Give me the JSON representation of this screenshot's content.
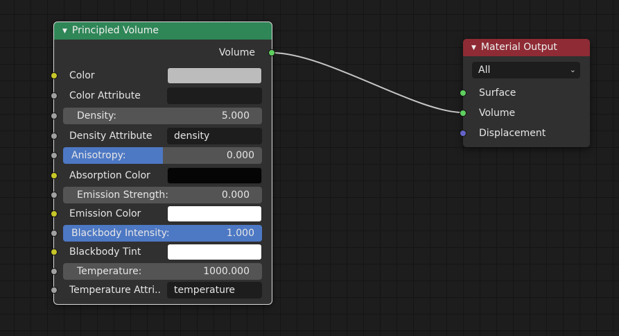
{
  "principled_volume": {
    "title": "Principled Volume",
    "header_color": "#2f8657",
    "output_label": "Volume",
    "color_label": "Color",
    "color_swatch": "#bcbcbc",
    "color_attribute_label": "Color Attribute",
    "color_attribute_value": "",
    "density": {
      "label": "Density:",
      "value": "5.000"
    },
    "density_attribute_label": "Density Attribute",
    "density_attribute_value": "density",
    "anisotropy": {
      "label": "Anisotropy:",
      "value": "0.000",
      "fill_fraction": 0.5
    },
    "absorption_color_label": "Absorption Color",
    "absorption_swatch": "#050505",
    "emission_strength": {
      "label": "Emission Strength:",
      "value": "0.000"
    },
    "emission_color_label": "Emission Color",
    "emission_swatch": "#ffffff",
    "blackbody_intensity": {
      "label": "Blackbody Intensity:",
      "value": "1.000",
      "fill_fraction": 1.0
    },
    "blackbody_tint_label": "Blackbody Tint",
    "blackbody_tint_swatch": "#ffffff",
    "temperature": {
      "label": "Temperature:",
      "value": "1000.000"
    },
    "temperature_attribute_label": "Temperature Attri..",
    "temperature_attribute_value": "temperature"
  },
  "material_output": {
    "title": "Material Output",
    "header_color": "#8e2b34",
    "target_select": "All",
    "surface_label": "Surface",
    "volume_label": "Volume",
    "displacement_label": "Displacement"
  },
  "socket_colors": {
    "shader": "#5fcf5f",
    "color": "#c7c729",
    "float": "#a1a1a1",
    "vector": "#6363c7"
  },
  "link_color": "#c6c6c6"
}
